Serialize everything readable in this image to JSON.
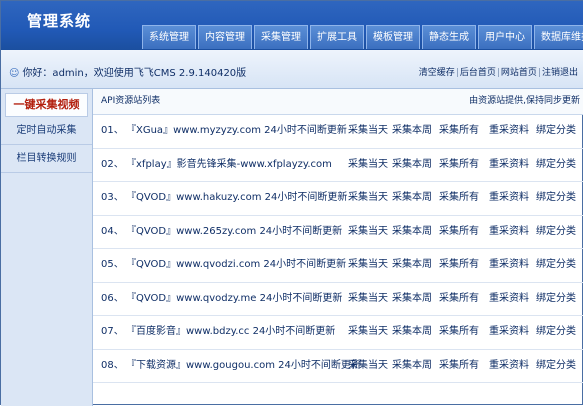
{
  "app": {
    "title": "管理系统"
  },
  "nav": [
    {
      "label": "系统管理"
    },
    {
      "label": "内容管理"
    },
    {
      "label": "采集管理"
    },
    {
      "label": "扩展工具"
    },
    {
      "label": "模板管理"
    },
    {
      "label": "静态生成"
    },
    {
      "label": "用户中心"
    },
    {
      "label": "数据库维护"
    }
  ],
  "welcome": "你好：admin，欢迎使用飞飞CMS 2.9.140420版",
  "top_links": [
    {
      "label": "清空缓存"
    },
    {
      "label": "后台首页"
    },
    {
      "label": "网站首页"
    },
    {
      "label": "注销退出"
    }
  ],
  "sidebar": [
    {
      "label": "一键采集视频"
    },
    {
      "label": "定时自动采集"
    },
    {
      "label": "栏目转换规则"
    }
  ],
  "main": {
    "title": "API资源站列表",
    "note": "由资源站提供,保持同步更新"
  },
  "actions": [
    "采集当天",
    "采集本周",
    "采集所有",
    "重采资料",
    "绑定分类"
  ],
  "rows": [
    {
      "index": "01、",
      "name": "『XGua』www.myzyzy.com 24小时不间断更新"
    },
    {
      "index": "02、",
      "name": "『xfplay』影音先锋采集-www.xfplayzy.com"
    },
    {
      "index": "03、",
      "name": "『QVOD』www.hakuzy.com 24小时不间断更新"
    },
    {
      "index": "04、",
      "name": "『QVOD』www.265zy.com 24小时不间断更新"
    },
    {
      "index": "05、",
      "name": "『QVOD』www.qvodzi.com 24小时不间断更新"
    },
    {
      "index": "06、",
      "name": "『QVOD』www.qvodzy.me 24小时不间断更新"
    },
    {
      "index": "07、",
      "name": "『百度影音』www.bdzy.cc 24小时不间断更新"
    },
    {
      "index": "08、",
      "name": "『下载资源』www.gougou.com 24小时不间断更新"
    }
  ]
}
